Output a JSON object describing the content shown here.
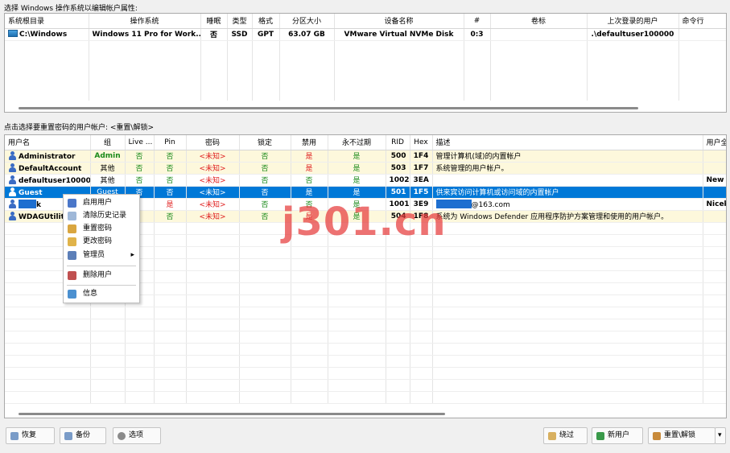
{
  "top_label": "选择 Windows 操作系统以编辑帐户属性:",
  "os_table": {
    "headers": [
      "系统根目录",
      "操作系统",
      "睡眠",
      "类型",
      "格式",
      "分区大小",
      "设备名称",
      "#",
      "卷标",
      "上次登录的用户",
      "命令行"
    ],
    "rows": [
      [
        "C:\\Windows",
        "Windows 11 Pro for Work...",
        "否",
        "SSD",
        "GPT",
        "63.07 GB",
        "VMware Virtual NVMe Disk",
        "0:3",
        "",
        ".\\defaultuser100000",
        ""
      ]
    ]
  },
  "mid_label": "点击选择要重置密码的用户帐户: <重置\\解锁>",
  "user_table": {
    "headers": [
      "用户名",
      "组",
      "Live ...",
      "Pin",
      "密码",
      "锁定",
      "禁用",
      "永不过期",
      "RID",
      "Hex",
      "描述",
      "用户全"
    ],
    "rows": [
      {
        "name": "Administrator",
        "group": "Admin",
        "live": "否",
        "pin": "否",
        "pwd": "<未知>",
        "lock": "否",
        "dis": "是",
        "nexp": "是",
        "rid": "500",
        "hex": "1F4",
        "desc": "管理计算机(域)的内置帐户",
        "full": ""
      },
      {
        "name": "DefaultAccount",
        "group": "其他",
        "live": "否",
        "pin": "否",
        "pwd": "<未知>",
        "lock": "否",
        "dis": "是",
        "nexp": "是",
        "rid": "503",
        "hex": "1F7",
        "desc": "系统管理的用户帐户。",
        "full": ""
      },
      {
        "name": "defaultuser100000",
        "group": "其他",
        "live": "否",
        "pin": "否",
        "pwd": "<未知>",
        "lock": "否",
        "dis": "否",
        "nexp": "是",
        "rid": "1002",
        "hex": "3EA",
        "desc": "",
        "full": "New U"
      },
      {
        "name": "Guest",
        "group": "Guest",
        "live": "否",
        "pin": "否",
        "pwd": "<未知>",
        "lock": "否",
        "dis": "是",
        "nexp": "是",
        "rid": "501",
        "hex": "1F5",
        "desc": "供来宾访问计算机或访问域的内置帐户",
        "full": ""
      },
      {
        "name": "k",
        "group": "",
        "live": "",
        "pin": "是",
        "pwd": "<未知>",
        "lock": "否",
        "dis": "否",
        "nexp": "是",
        "rid": "1001",
        "hex": "3E9",
        "desc": "@163.com",
        "full": "Nicek"
      },
      {
        "name": "WDAGUtility",
        "group": "",
        "live": "",
        "pin": "否",
        "pwd": "<未知>",
        "lock": "否",
        "dis": "是",
        "nexp": "是",
        "rid": "504",
        "hex": "1F8",
        "desc": "系统为 Windows Defender 应用程序防护方案管理和使用的用户帐户。",
        "full": ""
      }
    ]
  },
  "context_menu": [
    "启用用户",
    "清除历史记录",
    "重置密码",
    "更改密码",
    "管理员",
    "删除用户",
    "信息"
  ],
  "buttons": {
    "restore": "恢复",
    "backup": "备份",
    "options": "选项",
    "skip": "绕过",
    "new_user": "新用户",
    "reset_unlock": "重置\\解锁"
  },
  "watermark": "j301.cn",
  "colors": {
    "selection": "#0078d7",
    "yes_red": "#e02020",
    "admin_green": "#1a8a1a",
    "row_highlight": "#fdf8dc"
  }
}
